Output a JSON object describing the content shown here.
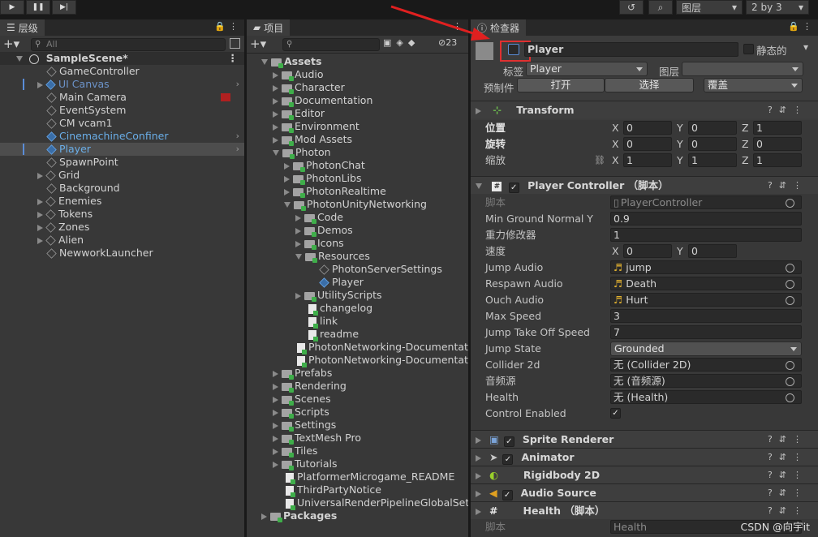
{
  "toolbar": {
    "layers": "图层",
    "layout": "2 by 3"
  },
  "hierarchy": {
    "tab": "层级",
    "search_placeholder": "All",
    "scene": "SampleScene*",
    "items": [
      {
        "label": "GameController",
        "color": "#d2d2d2",
        "expand": false,
        "chev": false
      },
      {
        "label": "UI Canvas",
        "color": "#6c93c9",
        "expand": true,
        "chev": true
      },
      {
        "label": "Main Camera",
        "color": "#d2d2d2",
        "expand": false,
        "chev": false
      },
      {
        "label": "EventSystem",
        "color": "#d2d2d2",
        "expand": false,
        "chev": false
      },
      {
        "label": "CM vcam1",
        "color": "#d2d2d2",
        "expand": false,
        "chev": false
      },
      {
        "label": "CinemachineConfiner",
        "color": "#6aaee8",
        "expand": false,
        "chev": true
      },
      {
        "label": "Player",
        "color": "#6aaee8",
        "expand": false,
        "chev": true
      },
      {
        "label": "SpawnPoint",
        "color": "#d2d2d2",
        "expand": false,
        "chev": false
      },
      {
        "label": "Grid",
        "color": "#d2d2d2",
        "expand": true,
        "chev": false
      },
      {
        "label": "Background",
        "color": "#d2d2d2",
        "expand": false,
        "chev": false
      },
      {
        "label": "Enemies",
        "color": "#d2d2d2",
        "expand": true,
        "chev": false
      },
      {
        "label": "Tokens",
        "color": "#d2d2d2",
        "expand": true,
        "chev": false
      },
      {
        "label": "Zones",
        "color": "#d2d2d2",
        "expand": true,
        "chev": false
      },
      {
        "label": "Alien",
        "color": "#d2d2d2",
        "expand": true,
        "chev": false
      },
      {
        "label": "NewworkLauncher",
        "color": "#d2d2d2",
        "expand": false,
        "chev": false
      }
    ]
  },
  "project": {
    "tab": "项目",
    "badge": "23",
    "items": [
      {
        "label": "Assets",
        "indent": 0,
        "kind": "folder",
        "tri": "open",
        "bold": true
      },
      {
        "label": "Audio",
        "indent": 1,
        "kind": "folder",
        "tri": "closed"
      },
      {
        "label": "Character",
        "indent": 1,
        "kind": "folder",
        "tri": "closed"
      },
      {
        "label": "Documentation",
        "indent": 1,
        "kind": "folder",
        "tri": "closed"
      },
      {
        "label": "Editor",
        "indent": 1,
        "kind": "folder",
        "tri": "closed"
      },
      {
        "label": "Environment",
        "indent": 1,
        "kind": "folder",
        "tri": "closed"
      },
      {
        "label": "Mod Assets",
        "indent": 1,
        "kind": "folder",
        "tri": "closed"
      },
      {
        "label": "Photon",
        "indent": 1,
        "kind": "folder",
        "tri": "open"
      },
      {
        "label": "PhotonChat",
        "indent": 2,
        "kind": "folder",
        "tri": "closed"
      },
      {
        "label": "PhotonLibs",
        "indent": 2,
        "kind": "folder",
        "tri": "closed"
      },
      {
        "label": "PhotonRealtime",
        "indent": 2,
        "kind": "folder",
        "tri": "closed"
      },
      {
        "label": "PhotonUnityNetworking",
        "indent": 2,
        "kind": "folder",
        "tri": "open"
      },
      {
        "label": "Code",
        "indent": 3,
        "kind": "folder",
        "tri": "closed"
      },
      {
        "label": "Demos",
        "indent": 3,
        "kind": "folder",
        "tri": "closed"
      },
      {
        "label": "Icons",
        "indent": 3,
        "kind": "folder",
        "tri": "closed"
      },
      {
        "label": "Resources",
        "indent": 3,
        "kind": "folder",
        "tri": "open"
      },
      {
        "label": "PhotonServerSettings",
        "indent": 4,
        "kind": "cube",
        "tri": "none"
      },
      {
        "label": "Player",
        "indent": 4,
        "kind": "cubeblue",
        "tri": "none"
      },
      {
        "label": "UtilityScripts",
        "indent": 3,
        "kind": "folder",
        "tri": "closed"
      },
      {
        "label": "changelog",
        "indent": 3,
        "kind": "file",
        "tri": "none"
      },
      {
        "label": "link",
        "indent": 3,
        "kind": "file",
        "tri": "none"
      },
      {
        "label": "readme",
        "indent": 3,
        "kind": "file",
        "tri": "none"
      },
      {
        "label": "PhotonNetworking-Documentation",
        "indent": 2,
        "kind": "file",
        "tri": "none"
      },
      {
        "label": "PhotonNetworking-Documentation",
        "indent": 2,
        "kind": "file",
        "tri": "none"
      },
      {
        "label": "Prefabs",
        "indent": 1,
        "kind": "folder",
        "tri": "closed"
      },
      {
        "label": "Rendering",
        "indent": 1,
        "kind": "folder",
        "tri": "closed"
      },
      {
        "label": "Scenes",
        "indent": 1,
        "kind": "folder",
        "tri": "closed"
      },
      {
        "label": "Scripts",
        "indent": 1,
        "kind": "folder",
        "tri": "closed"
      },
      {
        "label": "Settings",
        "indent": 1,
        "kind": "folder",
        "tri": "closed"
      },
      {
        "label": "TextMesh Pro",
        "indent": 1,
        "kind": "folder",
        "tri": "closed"
      },
      {
        "label": "Tiles",
        "indent": 1,
        "kind": "folder",
        "tri": "closed"
      },
      {
        "label": "Tutorials",
        "indent": 1,
        "kind": "folder",
        "tri": "closed"
      },
      {
        "label": "PlatformerMicrogame_README",
        "indent": 1,
        "kind": "file",
        "tri": "none"
      },
      {
        "label": "ThirdPartyNotice",
        "indent": 1,
        "kind": "file",
        "tri": "none"
      },
      {
        "label": "UniversalRenderPipelineGlobalSettings",
        "indent": 1,
        "kind": "file",
        "tri": "none"
      },
      {
        "label": "Packages",
        "indent": 0,
        "kind": "folder",
        "tri": "closed",
        "bold": true
      }
    ]
  },
  "inspector": {
    "tab": "检查器",
    "object_name": "Player",
    "static_label": "静态的",
    "tag_label": "标签",
    "tag_value": "Player",
    "layer_label": "图层",
    "prefab_label": "预制件",
    "open_btn": "打开",
    "select_btn": "选择",
    "override_btn": "覆盖",
    "transform": {
      "title": "Transform",
      "position": "位置",
      "rotation": "旋转",
      "scale": "缩放",
      "pos": [
        "0",
        "0",
        "1"
      ],
      "rot": [
        "0",
        "0",
        "0"
      ],
      "scl": [
        "1",
        "1",
        "1"
      ]
    },
    "axis": {
      "x": "X",
      "y": "Y",
      "z": "Z"
    },
    "player_controller": {
      "title": "Player Controller （脚本）",
      "rows": [
        {
          "label": "脚本",
          "value": "PlayerController",
          "type": "script"
        },
        {
          "label": "Min Ground Normal Y",
          "value": "0.9",
          "type": "text"
        },
        {
          "label": "重力修改器",
          "value": "1",
          "type": "text"
        },
        {
          "label": "速度",
          "type": "vec2",
          "x": "0",
          "y": "0"
        },
        {
          "label": "Jump Audio",
          "value": "jump",
          "type": "audio"
        },
        {
          "label": "Respawn Audio",
          "value": "Death",
          "type": "audio"
        },
        {
          "label": "Ouch Audio",
          "value": "Hurt",
          "type": "audio"
        },
        {
          "label": "Max Speed",
          "value": "3",
          "type": "text"
        },
        {
          "label": "Jump Take Off Speed",
          "value": "7",
          "type": "text"
        },
        {
          "label": "Jump State",
          "value": "Grounded",
          "type": "enum"
        },
        {
          "label": "Collider 2d",
          "value": "无 (Collider 2D)",
          "type": "object"
        },
        {
          "label": "音频源",
          "value": "无 (音频源)",
          "type": "object"
        },
        {
          "label": "Health",
          "value": "无 (Health)",
          "type": "object"
        },
        {
          "label": "Control Enabled",
          "type": "bool"
        }
      ]
    },
    "components": [
      {
        "title": "Sprite Renderer",
        "check": true
      },
      {
        "title": "Animator",
        "check": true
      },
      {
        "title": "Rigidbody 2D",
        "check": false
      },
      {
        "title": "Audio Source",
        "check": true
      },
      {
        "title": "Health （脚本）",
        "check": false
      }
    ],
    "health_script_label": "脚本",
    "health_script_value": "Health"
  },
  "watermark": "CSDN @向宇it"
}
